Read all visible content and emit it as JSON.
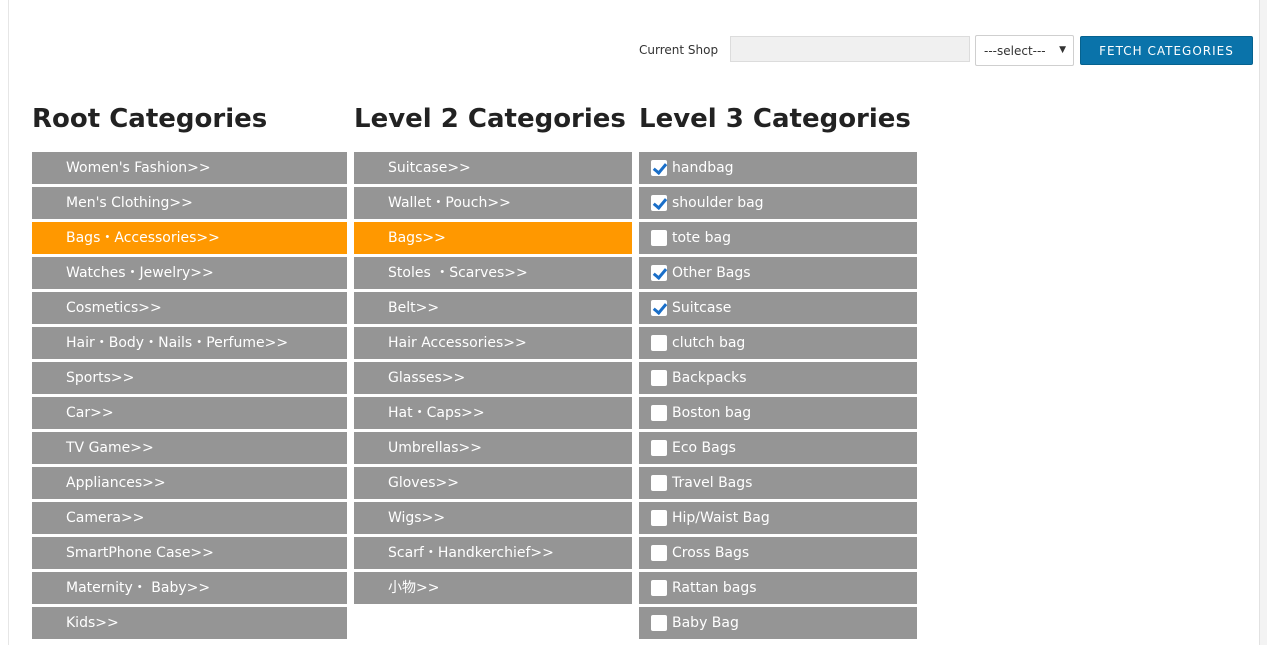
{
  "toolbar": {
    "shop_label": "Current Shop",
    "shop_value": "",
    "select_value": "---select---",
    "fetch_label": "FETCH CATEGORIES"
  },
  "root": {
    "title": "Root Categories",
    "items": [
      {
        "label": "Women's Fashion>>",
        "active": false
      },
      {
        "label": "Men's Clothing>>",
        "active": false
      },
      {
        "label": "Bags・Accessories>>",
        "active": true
      },
      {
        "label": "Watches・Jewelry>>",
        "active": false
      },
      {
        "label": "Cosmetics>>",
        "active": false
      },
      {
        "label": "Hair・Body・Nails・Perfume>>",
        "active": false
      },
      {
        "label": "Sports>>",
        "active": false
      },
      {
        "label": "Car>>",
        "active": false
      },
      {
        "label": "TV Game>>",
        "active": false
      },
      {
        "label": "Appliances>>",
        "active": false
      },
      {
        "label": "Camera>>",
        "active": false
      },
      {
        "label": "SmartPhone Case>>",
        "active": false
      },
      {
        "label": "Maternity・ Baby>>",
        "active": false
      },
      {
        "label": "Kids>>",
        "active": false
      }
    ]
  },
  "level2": {
    "title": "Level 2 Categories",
    "items": [
      {
        "label": "Suitcase>>",
        "active": false
      },
      {
        "label": "Wallet・Pouch>>",
        "active": false
      },
      {
        "label": "Bags>>",
        "active": true
      },
      {
        "label": "Stoles ・Scarves>>",
        "active": false
      },
      {
        "label": "Belt>>",
        "active": false
      },
      {
        "label": "Hair Accessories>>",
        "active": false
      },
      {
        "label": "Glasses>>",
        "active": false
      },
      {
        "label": "Hat・Caps>>",
        "active": false
      },
      {
        "label": "Umbrellas>>",
        "active": false
      },
      {
        "label": "Gloves>>",
        "active": false
      },
      {
        "label": "Wigs>>",
        "active": false
      },
      {
        "label": "Scarf・Handkerchief>>",
        "active": false
      },
      {
        "label": "小物>>",
        "active": false
      }
    ]
  },
  "level3": {
    "title": "Level 3 Categories",
    "items": [
      {
        "label": "handbag",
        "checked": true
      },
      {
        "label": "shoulder bag",
        "checked": true
      },
      {
        "label": "tote bag",
        "checked": false
      },
      {
        "label": "Other Bags",
        "checked": true
      },
      {
        "label": "Suitcase",
        "checked": true
      },
      {
        "label": "clutch bag",
        "checked": false
      },
      {
        "label": "Backpacks",
        "checked": false
      },
      {
        "label": "Boston bag",
        "checked": false
      },
      {
        "label": "Eco Bags",
        "checked": false
      },
      {
        "label": "Travel Bags",
        "checked": false
      },
      {
        "label": "Hip/Waist Bag",
        "checked": false
      },
      {
        "label": "Cross Bags",
        "checked": false
      },
      {
        "label": "Rattan bags",
        "checked": false
      },
      {
        "label": "Baby Bag",
        "checked": false
      }
    ]
  },
  "colors": {
    "item_bg": "#959595",
    "active_bg": "#ff9800",
    "button_bg": "#0a73aa",
    "check_color": "#1a6fc9"
  }
}
